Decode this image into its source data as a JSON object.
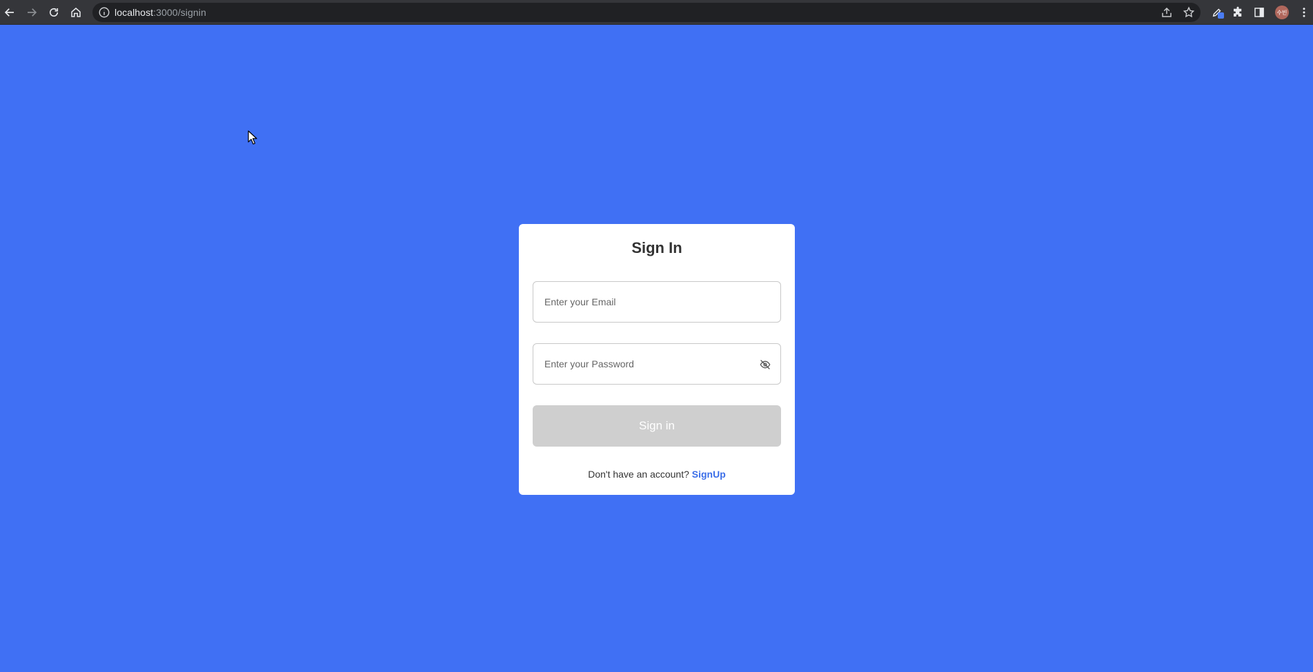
{
  "browser": {
    "url_host": "localhost",
    "url_path": ":3000/signin",
    "profile_initials": "수빈"
  },
  "signin": {
    "title": "Sign In",
    "email_placeholder": "Enter your Email",
    "password_placeholder": "Enter your Password",
    "submit_label": "Sign in",
    "footer_text": "Don't have an account?",
    "signup_link": "SignUp"
  },
  "colors": {
    "background": "#4070f4",
    "button_disabled": "#cfcfcf",
    "link": "#3b6ee8"
  },
  "icons": {
    "password_toggle": "eye-off-icon"
  }
}
